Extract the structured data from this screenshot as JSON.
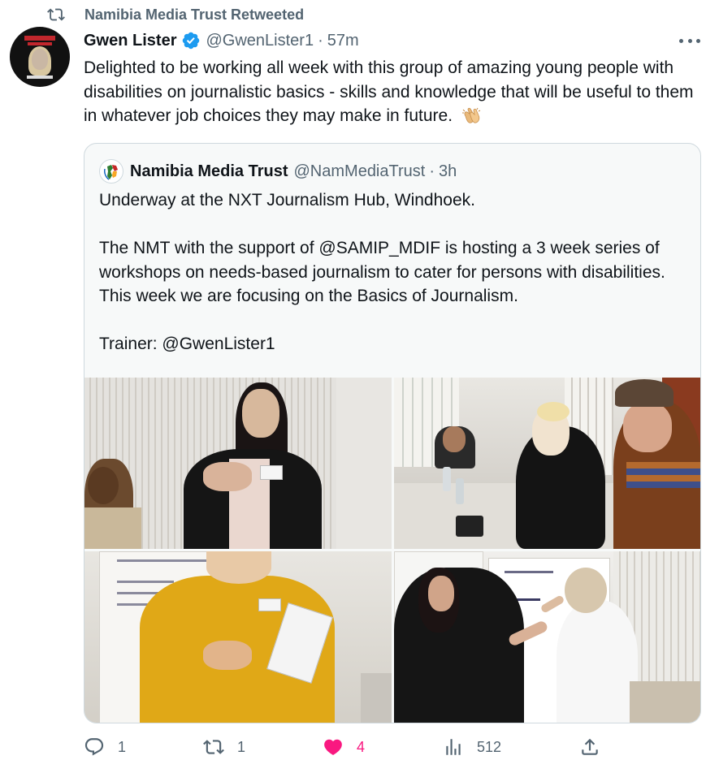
{
  "retweet": {
    "label": "Namibia Media Trust Retweeted",
    "icon": "retweet-icon"
  },
  "tweet": {
    "author_name": "Gwen Lister",
    "verified": true,
    "handle": "@GwenLister1",
    "separator": "·",
    "time": "57m",
    "text": "Delighted to be working all week with this group of amazing young people with disabilities on journalistic basics - skills and knowledge that will be useful to them in whatever job choices they may make in future.",
    "emoji": "clapping-hands-emoji",
    "more_icon": "more-icon"
  },
  "quote": {
    "author_name": "Namibia Media Trust",
    "handle": "@NamMediaTrust",
    "separator": "·",
    "time": "3h",
    "paragraphs": [
      "Underway at the NXT Journalism Hub, Windhoek.",
      "",
      "The NMT with the support of @SAMIP_MDIF is hosting a 3 week series of workshops on needs-based journalism to cater for persons with disabilities. This week we are focusing on the Basics of Journalism.",
      "",
      "Trainer: @GwenLister1"
    ],
    "photos": [
      "Photo of a woman in a black blazer speaking, with another woman seated at left",
      "Photo of workshop participants seated around a table",
      "Photo of a person in a yellow sweater holding a notebook by a flip chart",
      "Photo of two women writing on a flip chart"
    ]
  },
  "actions": {
    "reply": {
      "icon": "reply-icon",
      "count": "1"
    },
    "retweet": {
      "icon": "retweet-icon",
      "count": "1"
    },
    "like": {
      "icon": "heart-icon",
      "count": "4",
      "color": "#f91880"
    },
    "views": {
      "icon": "views-icon",
      "count": "512"
    },
    "share": {
      "icon": "share-icon"
    }
  },
  "colors": {
    "text": "#0f1419",
    "secondary": "#536471",
    "verified": "#1d9bf0",
    "border": "#cfd9de",
    "quote_bg": "#f7f9f9",
    "like": "#f91880"
  }
}
